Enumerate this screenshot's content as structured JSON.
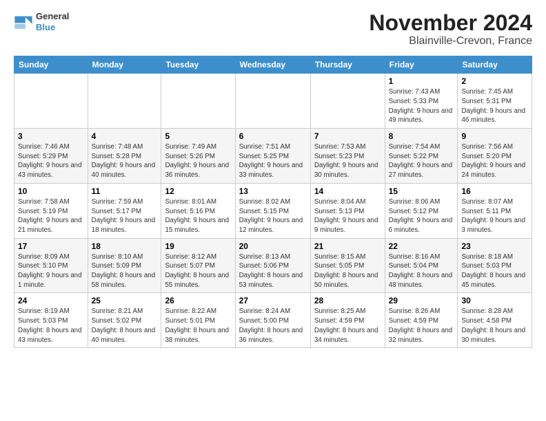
{
  "logo": {
    "name1": "General",
    "name2": "Blue"
  },
  "title": "November 2024",
  "subtitle": "Blainville-Crevon, France",
  "weekdays": [
    "Sunday",
    "Monday",
    "Tuesday",
    "Wednesday",
    "Thursday",
    "Friday",
    "Saturday"
  ],
  "weeks": [
    [
      {
        "day": "",
        "info": ""
      },
      {
        "day": "",
        "info": ""
      },
      {
        "day": "",
        "info": ""
      },
      {
        "day": "",
        "info": ""
      },
      {
        "day": "",
        "info": ""
      },
      {
        "day": "1",
        "info": "Sunrise: 7:43 AM\nSunset: 5:33 PM\nDaylight: 9 hours and 49 minutes."
      },
      {
        "day": "2",
        "info": "Sunrise: 7:45 AM\nSunset: 5:31 PM\nDaylight: 9 hours and 46 minutes."
      }
    ],
    [
      {
        "day": "3",
        "info": "Sunrise: 7:46 AM\nSunset: 5:29 PM\nDaylight: 9 hours and 43 minutes."
      },
      {
        "day": "4",
        "info": "Sunrise: 7:48 AM\nSunset: 5:28 PM\nDaylight: 9 hours and 40 minutes."
      },
      {
        "day": "5",
        "info": "Sunrise: 7:49 AM\nSunset: 5:26 PM\nDaylight: 9 hours and 36 minutes."
      },
      {
        "day": "6",
        "info": "Sunrise: 7:51 AM\nSunset: 5:25 PM\nDaylight: 9 hours and 33 minutes."
      },
      {
        "day": "7",
        "info": "Sunrise: 7:53 AM\nSunset: 5:23 PM\nDaylight: 9 hours and 30 minutes."
      },
      {
        "day": "8",
        "info": "Sunrise: 7:54 AM\nSunset: 5:22 PM\nDaylight: 9 hours and 27 minutes."
      },
      {
        "day": "9",
        "info": "Sunrise: 7:56 AM\nSunset: 5:20 PM\nDaylight: 9 hours and 24 minutes."
      }
    ],
    [
      {
        "day": "10",
        "info": "Sunrise: 7:58 AM\nSunset: 5:19 PM\nDaylight: 9 hours and 21 minutes."
      },
      {
        "day": "11",
        "info": "Sunrise: 7:59 AM\nSunset: 5:17 PM\nDaylight: 9 hours and 18 minutes."
      },
      {
        "day": "12",
        "info": "Sunrise: 8:01 AM\nSunset: 5:16 PM\nDaylight: 9 hours and 15 minutes."
      },
      {
        "day": "13",
        "info": "Sunrise: 8:02 AM\nSunset: 5:15 PM\nDaylight: 9 hours and 12 minutes."
      },
      {
        "day": "14",
        "info": "Sunrise: 8:04 AM\nSunset: 5:13 PM\nDaylight: 9 hours and 9 minutes."
      },
      {
        "day": "15",
        "info": "Sunrise: 8:06 AM\nSunset: 5:12 PM\nDaylight: 9 hours and 6 minutes."
      },
      {
        "day": "16",
        "info": "Sunrise: 8:07 AM\nSunset: 5:11 PM\nDaylight: 9 hours and 3 minutes."
      }
    ],
    [
      {
        "day": "17",
        "info": "Sunrise: 8:09 AM\nSunset: 5:10 PM\nDaylight: 9 hours and 1 minute."
      },
      {
        "day": "18",
        "info": "Sunrise: 8:10 AM\nSunset: 5:09 PM\nDaylight: 8 hours and 58 minutes."
      },
      {
        "day": "19",
        "info": "Sunrise: 8:12 AM\nSunset: 5:07 PM\nDaylight: 8 hours and 55 minutes."
      },
      {
        "day": "20",
        "info": "Sunrise: 8:13 AM\nSunset: 5:06 PM\nDaylight: 8 hours and 53 minutes."
      },
      {
        "day": "21",
        "info": "Sunrise: 8:15 AM\nSunset: 5:05 PM\nDaylight: 8 hours and 50 minutes."
      },
      {
        "day": "22",
        "info": "Sunrise: 8:16 AM\nSunset: 5:04 PM\nDaylight: 8 hours and 48 minutes."
      },
      {
        "day": "23",
        "info": "Sunrise: 8:18 AM\nSunset: 5:03 PM\nDaylight: 8 hours and 45 minutes."
      }
    ],
    [
      {
        "day": "24",
        "info": "Sunrise: 8:19 AM\nSunset: 5:03 PM\nDaylight: 8 hours and 43 minutes."
      },
      {
        "day": "25",
        "info": "Sunrise: 8:21 AM\nSunset: 5:02 PM\nDaylight: 8 hours and 40 minutes."
      },
      {
        "day": "26",
        "info": "Sunrise: 8:22 AM\nSunset: 5:01 PM\nDaylight: 8 hours and 38 minutes."
      },
      {
        "day": "27",
        "info": "Sunrise: 8:24 AM\nSunset: 5:00 PM\nDaylight: 8 hours and 36 minutes."
      },
      {
        "day": "28",
        "info": "Sunrise: 8:25 AM\nSunset: 4:59 PM\nDaylight: 8 hours and 34 minutes."
      },
      {
        "day": "29",
        "info": "Sunrise: 8:26 AM\nSunset: 4:59 PM\nDaylight: 8 hours and 32 minutes."
      },
      {
        "day": "30",
        "info": "Sunrise: 8:28 AM\nSunset: 4:58 PM\nDaylight: 8 hours and 30 minutes."
      }
    ]
  ]
}
